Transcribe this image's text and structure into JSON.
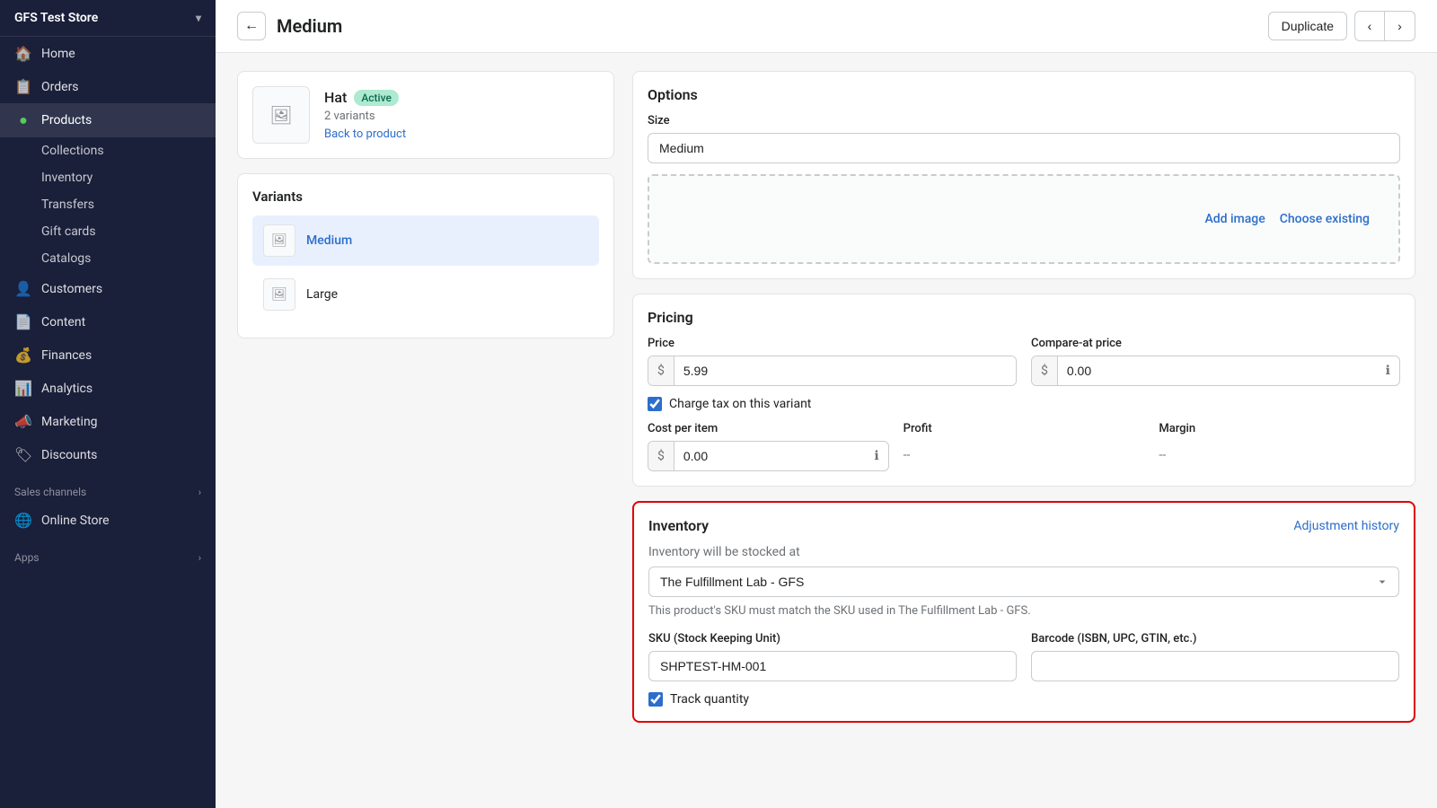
{
  "store": {
    "name": "GFS Test Store",
    "dropdown_icon": "▾"
  },
  "sidebar": {
    "nav_items": [
      {
        "id": "home",
        "label": "Home",
        "icon": "🏠",
        "active": false
      },
      {
        "id": "orders",
        "label": "Orders",
        "icon": "📋",
        "active": false
      },
      {
        "id": "products",
        "label": "Products",
        "icon": "●",
        "active": true
      }
    ],
    "products_sub": [
      {
        "id": "collections",
        "label": "Collections",
        "active": false
      },
      {
        "id": "inventory",
        "label": "Inventory",
        "active": false
      },
      {
        "id": "transfers",
        "label": "Transfers",
        "active": false
      },
      {
        "id": "gift_cards",
        "label": "Gift cards",
        "active": false
      },
      {
        "id": "catalogs",
        "label": "Catalogs",
        "active": false
      }
    ],
    "other_nav": [
      {
        "id": "customers",
        "label": "Customers",
        "icon": "👤"
      },
      {
        "id": "content",
        "label": "Content",
        "icon": "📄"
      },
      {
        "id": "finances",
        "label": "Finances",
        "icon": "💰"
      },
      {
        "id": "analytics",
        "label": "Analytics",
        "icon": "📊"
      },
      {
        "id": "marketing",
        "label": "Marketing",
        "icon": "📣"
      },
      {
        "id": "discounts",
        "label": "Discounts",
        "icon": "🏷"
      }
    ],
    "sales_channels_label": "Sales channels",
    "online_store_label": "Online Store",
    "online_store_icon": "🌐",
    "apps_label": "Apps"
  },
  "topbar": {
    "back_button_icon": "←",
    "page_title": "Medium",
    "duplicate_label": "Duplicate",
    "prev_icon": "‹",
    "next_icon": "›"
  },
  "product_card": {
    "thumb_icon": "🖼",
    "name": "Hat",
    "badge": "Active",
    "variants_text": "2 variants",
    "back_link": "Back to product"
  },
  "variants_card": {
    "title": "Variants",
    "items": [
      {
        "id": "medium",
        "label": "Medium",
        "active": true
      },
      {
        "id": "large",
        "label": "Large",
        "active": false
      }
    ],
    "thumb_icon": "🖼"
  },
  "options": {
    "title": "Options",
    "size_label": "Size",
    "size_value": "Medium",
    "add_image_label": "Add image",
    "choose_existing_label": "Choose existing"
  },
  "pricing": {
    "title": "Pricing",
    "price_label": "Price",
    "price_currency": "$",
    "price_value": "5.99",
    "compare_label": "Compare-at price",
    "compare_currency": "$",
    "compare_value": "0.00",
    "charge_tax_label": "Charge tax on this variant",
    "charge_tax_checked": true,
    "cost_label": "Cost per item",
    "cost_currency": "$",
    "cost_value": "0.00",
    "profit_label": "Profit",
    "profit_value": "--",
    "margin_label": "Margin",
    "margin_value": "--"
  },
  "inventory": {
    "title": "Inventory",
    "adjustment_label": "Adjustment history",
    "stocked_label": "Inventory will be stocked at",
    "fulfillment_options": [
      "The Fulfillment Lab - GFS"
    ],
    "selected_fulfillment": "The Fulfillment Lab - GFS",
    "warning_text": "This product's SKU must match the SKU used in The Fulfillment Lab - GFS.",
    "sku_label": "SKU (Stock Keeping Unit)",
    "sku_value": "SHPTEST-HM-001",
    "sku_placeholder": "",
    "barcode_label": "Barcode (ISBN, UPC, GTIN, etc.)",
    "barcode_value": "",
    "track_quantity_label": "Track quantity",
    "track_quantity_checked": true
  }
}
